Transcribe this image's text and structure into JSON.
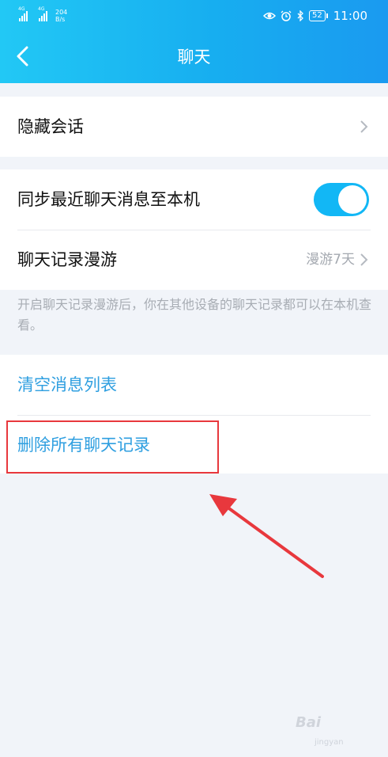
{
  "status_bar": {
    "signal_1_tag": "4G",
    "signal_2_tag": "4G",
    "net_speed_value": "204",
    "net_speed_unit": "B/s",
    "battery": "52",
    "time": "11:00"
  },
  "header": {
    "title": "聊天"
  },
  "rows": {
    "hide_session": "隐藏会话",
    "sync_recent": "同步最近聊天消息至本机",
    "sync_recent_on": true,
    "roaming": "聊天记录漫游",
    "roaming_value": "漫游7天",
    "roaming_desc": "开启聊天记录漫游后，你在其他设备的聊天记录都可以在本机查看。",
    "clear_list": "清空消息列表",
    "delete_all": "删除所有聊天记录"
  },
  "colors": {
    "header_start": "#22c8f5",
    "header_end": "#1a9af0",
    "toggle_on": "#12b7f5",
    "link_blue": "#2f9fe0",
    "highlight_red": "#e8383d"
  },
  "watermark": {
    "brand": "Bai",
    "sub": "jingyan"
  }
}
